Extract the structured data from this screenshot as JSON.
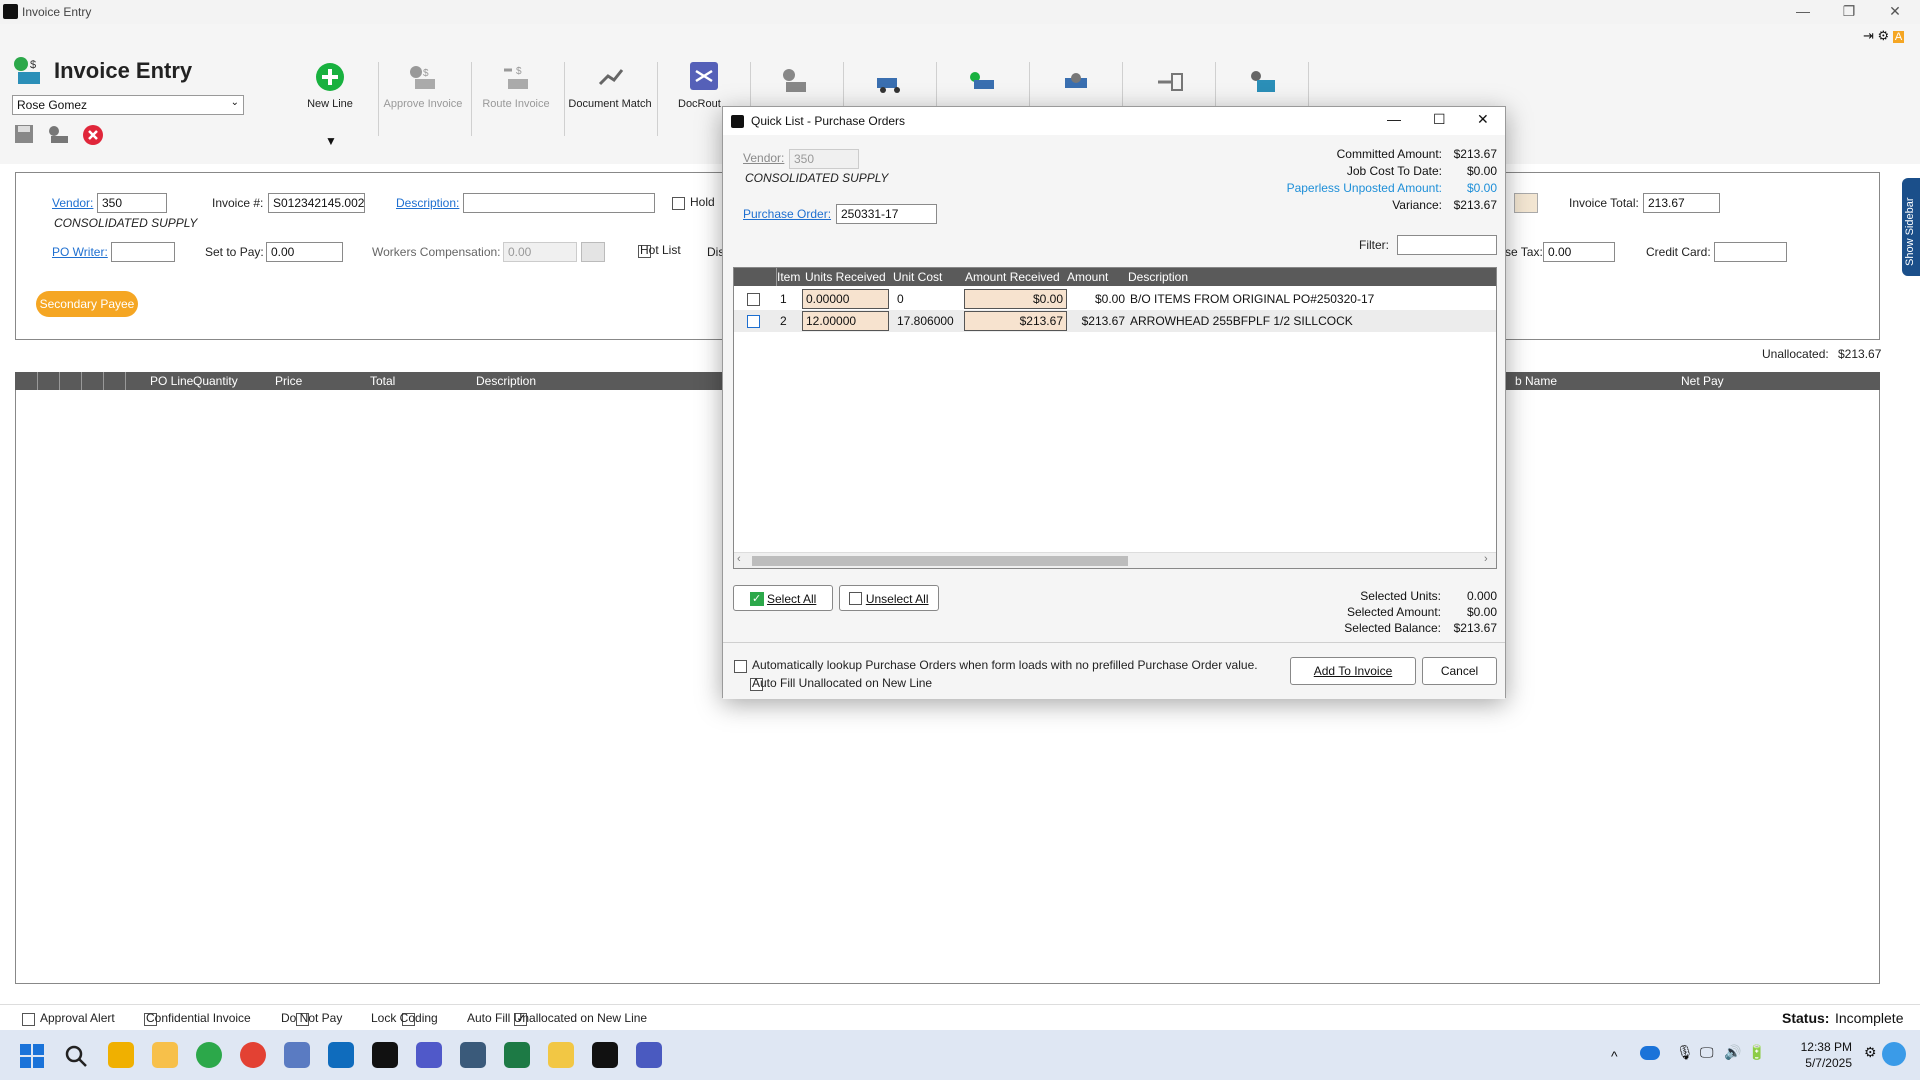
{
  "window": {
    "title": "Invoice Entry",
    "minimize": "—",
    "restore": "❐",
    "close": "✕"
  },
  "header": {
    "app_title": "Invoice Entry",
    "user": "Rose Gomez"
  },
  "ribbon": {
    "new_line": "New Line",
    "approve_invoice": "Approve Invoice",
    "route_invoice": "Route Invoice",
    "document_match": "Document Match",
    "doc_route": "DocRout",
    "dropdown_arrow": "▼"
  },
  "form": {
    "vendor_label": "Vendor:",
    "vendor_value": "350",
    "vendor_name": "CONSOLIDATED SUPPLY",
    "invoice_no_label": "Invoice #:",
    "invoice_no_value": "S012342145.002",
    "description_label": "Description:",
    "description_value": "",
    "hold_label": "Hold",
    "po_writer_label": "PO Writer:",
    "po_writer_value": "",
    "set_to_pay_label": "Set to Pay:",
    "set_to_pay_value": "0.00",
    "workers_comp_label": "Workers Compensation:",
    "workers_comp_value": "0.00",
    "hot_list_label": "Hot List",
    "dis_label": "Dis",
    "invoice_total_label": "Invoice Total:",
    "invoice_total_value": "213.67",
    "se_tax_label": "se Tax:",
    "se_tax_value": "0.00",
    "credit_card_label": "Credit Card:",
    "credit_card_value": "",
    "secondary_payee": "Secondary Payee",
    "unallocated_label": "Unallocated:",
    "unallocated_value": "$213.67"
  },
  "main_grid": {
    "columns": [
      "PO Line",
      "Quantity",
      "Price",
      "Total",
      "Description",
      "b Name",
      "Net Pay"
    ]
  },
  "sidebar_tab": "Show Sidebar",
  "status_bar": {
    "approval_alert": "Approval Alert",
    "confidential_invoice": "Confidential Invoice",
    "do_not_pay": "Do Not Pay",
    "lock_coding": "Lock Coding",
    "auto_fill": "Auto Fill Unallocated on New Line",
    "status_label": "Status:",
    "status_value": "Incomplete"
  },
  "dialog": {
    "title": "Quick List - Purchase Orders",
    "vendor_label": "Vendor:",
    "vendor_value": "350",
    "vendor_name": "CONSOLIDATED SUPPLY",
    "purchase_order_label": "Purchase Order:",
    "purchase_order_value": "250331-17",
    "summary": [
      {
        "label": "Committed Amount:",
        "value": "$213.67",
        "highlight": false
      },
      {
        "label": "Job Cost To Date:",
        "value": "$0.00",
        "highlight": false
      },
      {
        "label": "Paperless Unposted Amount:",
        "value": "$0.00",
        "highlight": true
      },
      {
        "label": "Variance:",
        "value": "$213.67",
        "highlight": false
      }
    ],
    "filter_label": "Filter:",
    "filter_value": "",
    "columns": [
      "Item",
      "Units Received",
      "Unit Cost",
      "Amount Received",
      "Amount",
      "Description"
    ],
    "rows": [
      {
        "item": "1",
        "units_received": "0.00000",
        "unit_cost": "0",
        "amount_received": "$0.00",
        "amount": "$0.00",
        "description": "B/O ITEMS FROM ORIGINAL PO#250320-17"
      },
      {
        "item": "2",
        "units_received": "12.00000",
        "unit_cost": "17.806000",
        "amount_received": "$213.67",
        "amount": "$213.67",
        "description": "ARROWHEAD 255BFPLF 1/2 SILLCOCK"
      }
    ],
    "select_all": "Select All",
    "unselect_all": "Unselect All",
    "totals": [
      {
        "label": "Selected Units:",
        "value": "0.000"
      },
      {
        "label": "Selected Amount:",
        "value": "$0.00"
      },
      {
        "label": "Selected Balance:",
        "value": "$213.67"
      }
    ],
    "auto_lookup": "Automatically lookup Purchase Orders when form loads with no prefilled Purchase Order value.",
    "auto_fill": "Auto Fill Unallocated on New Line",
    "add_to_invoice": "Add To Invoice",
    "cancel": "Cancel"
  },
  "taskbar": {
    "time": "12:38 PM",
    "date": "5/7/2025"
  },
  "colors": {
    "accent_link": "#1e6fd0",
    "orange": "#f5a623",
    "grid_header": "#5a5a5a",
    "peach_cell": "#f7e3cf"
  }
}
